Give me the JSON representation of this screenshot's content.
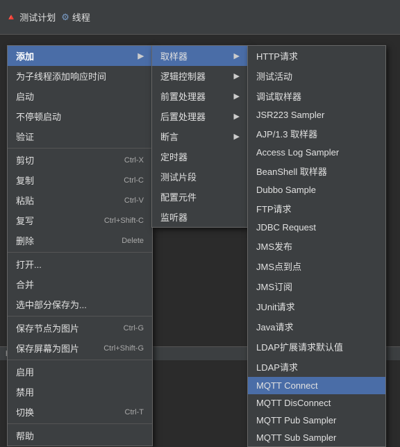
{
  "topbar": {
    "title": "测试计划",
    "subtitle": "线程"
  },
  "menu1": {
    "items": [
      {
        "id": "add",
        "label": "添加",
        "shortcut": "",
        "hasArrow": true,
        "active": true,
        "dividerAfter": false
      },
      {
        "id": "add-think-time",
        "label": "为子线程添加响应时间",
        "shortcut": "",
        "hasArrow": false,
        "active": false,
        "dividerAfter": false
      },
      {
        "id": "start",
        "label": "启动",
        "shortcut": "",
        "hasArrow": false,
        "active": false,
        "dividerAfter": false
      },
      {
        "id": "start-no-pause",
        "label": "不停顿启动",
        "shortcut": "",
        "hasArrow": false,
        "active": false,
        "dividerAfter": false
      },
      {
        "id": "validate",
        "label": "验证",
        "shortcut": "",
        "hasArrow": false,
        "active": false,
        "dividerAfter": true
      },
      {
        "id": "cut",
        "label": "剪切",
        "shortcut": "Ctrl-X",
        "hasArrow": false,
        "active": false,
        "dividerAfter": false
      },
      {
        "id": "copy",
        "label": "复制",
        "shortcut": "Ctrl-C",
        "hasArrow": false,
        "active": false,
        "dividerAfter": false
      },
      {
        "id": "paste",
        "label": "粘贴",
        "shortcut": "Ctrl-V",
        "hasArrow": false,
        "active": false,
        "dividerAfter": false
      },
      {
        "id": "duplicate",
        "label": "复写",
        "shortcut": "Ctrl+Shift-C",
        "hasArrow": false,
        "active": false,
        "dividerAfter": false
      },
      {
        "id": "delete",
        "label": "删除",
        "shortcut": "Delete",
        "hasArrow": false,
        "active": false,
        "dividerAfter": true
      },
      {
        "id": "open",
        "label": "打开...",
        "shortcut": "",
        "hasArrow": false,
        "active": false,
        "dividerAfter": false
      },
      {
        "id": "merge",
        "label": "合并",
        "shortcut": "",
        "hasArrow": false,
        "active": false,
        "dividerAfter": false
      },
      {
        "id": "save-selection",
        "label": "选中部分保存为...",
        "shortcut": "",
        "hasArrow": false,
        "active": false,
        "dividerAfter": true
      },
      {
        "id": "save-node-as-image",
        "label": "保存节点为图片",
        "shortcut": "Ctrl-G",
        "hasArrow": false,
        "active": false,
        "dividerAfter": false
      },
      {
        "id": "save-screen-as-image",
        "label": "保存屏幕为图片",
        "shortcut": "Ctrl+Shift-G",
        "hasArrow": false,
        "active": false,
        "dividerAfter": true
      },
      {
        "id": "enable",
        "label": "启用",
        "shortcut": "",
        "hasArrow": false,
        "active": false,
        "dividerAfter": false
      },
      {
        "id": "disable",
        "label": "禁用",
        "shortcut": "",
        "hasArrow": false,
        "active": false,
        "dividerAfter": false
      },
      {
        "id": "toggle",
        "label": "切换",
        "shortcut": "Ctrl-T",
        "hasArrow": false,
        "active": false,
        "dividerAfter": true
      },
      {
        "id": "help",
        "label": "帮助",
        "shortcut": "",
        "hasArrow": false,
        "active": false,
        "dividerAfter": false
      }
    ]
  },
  "menu2": {
    "items": [
      {
        "id": "sampler",
        "label": "取样器",
        "hasArrow": true,
        "active": true
      },
      {
        "id": "logic-controller",
        "label": "逻辑控制器",
        "hasArrow": true,
        "active": false
      },
      {
        "id": "pre-processor",
        "label": "前置处理器",
        "hasArrow": true,
        "active": false
      },
      {
        "id": "post-processor",
        "label": "后置处理器",
        "hasArrow": true,
        "active": false
      },
      {
        "id": "assertion",
        "label": "断言",
        "hasArrow": true,
        "active": false
      },
      {
        "id": "timer",
        "label": "定时器",
        "hasArrow": false,
        "active": false
      },
      {
        "id": "test-fragment",
        "label": "测试片段",
        "hasArrow": false,
        "active": false
      },
      {
        "id": "config-element",
        "label": "配置元件",
        "hasArrow": false,
        "active": false
      },
      {
        "id": "listener",
        "label": "监听器",
        "hasArrow": false,
        "active": false
      }
    ]
  },
  "menu3": {
    "items": [
      {
        "id": "http-request",
        "label": "HTTP请求",
        "active": false
      },
      {
        "id": "test-activity",
        "label": "测试活动",
        "active": false
      },
      {
        "id": "debug-sampler",
        "label": "调试取样器",
        "active": false
      },
      {
        "id": "jsr223-sampler",
        "label": "JSR223 Sampler",
        "active": false
      },
      {
        "id": "ajp-sampler",
        "label": "AJP/1.3 取样器",
        "active": false
      },
      {
        "id": "access-log-sampler",
        "label": "Access Log Sampler",
        "active": false
      },
      {
        "id": "beanshell-sampler",
        "label": "BeanShell 取样器",
        "active": false
      },
      {
        "id": "dubbo-sample",
        "label": "Dubbo Sample",
        "active": false
      },
      {
        "id": "ftp-request",
        "label": "FTP请求",
        "active": false
      },
      {
        "id": "jdbc-request",
        "label": "JDBC Request",
        "active": false
      },
      {
        "id": "jms-publish",
        "label": "JMS发布",
        "active": false
      },
      {
        "id": "jms-point",
        "label": "JMS点到点",
        "active": false
      },
      {
        "id": "jms-subscribe",
        "label": "JMS订阅",
        "active": false
      },
      {
        "id": "junit-request",
        "label": "JUnit请求",
        "active": false
      },
      {
        "id": "java-request",
        "label": "Java请求",
        "active": false
      },
      {
        "id": "ldap-extended",
        "label": "LDAP扩展请求默认值",
        "active": false
      },
      {
        "id": "ldap-request",
        "label": "LDAP请求",
        "active": false
      },
      {
        "id": "mqtt-connect",
        "label": "MQTT Connect",
        "active": true
      },
      {
        "id": "mqtt-disconnect",
        "label": "MQTT DisConnect",
        "active": false
      },
      {
        "id": "mqtt-pub-sampler",
        "label": "MQTT Pub Sampler",
        "active": false
      },
      {
        "id": "mqtt-sub-sampler",
        "label": "MQTT Sub Sampler",
        "active": false
      }
    ]
  },
  "statusbar": {
    "url": "https://blog.csdn.net/webler_35705138"
  }
}
